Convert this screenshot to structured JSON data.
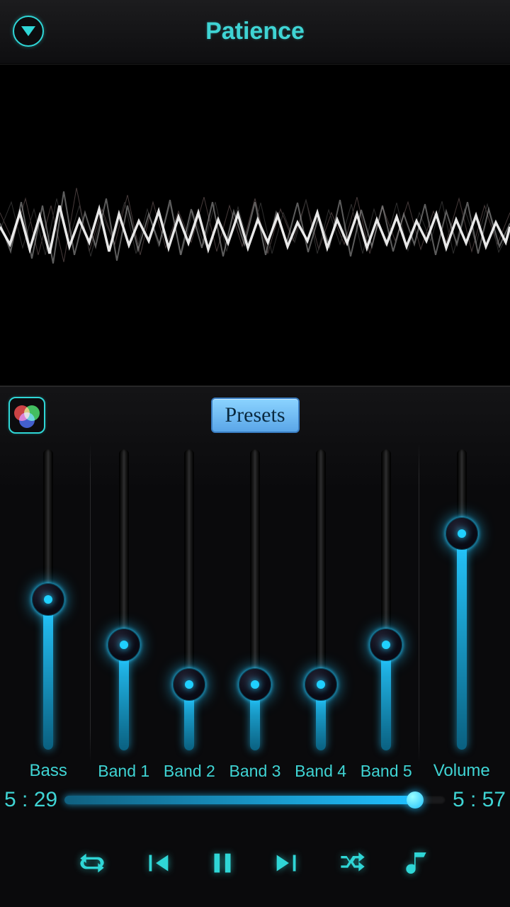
{
  "header": {
    "title": "Patience"
  },
  "equalizer": {
    "presets_label": "Presets",
    "sliders": [
      {
        "label": "Bass",
        "value": 0.5
      },
      {
        "label": "Band 1",
        "value": 0.35
      },
      {
        "label": "Band 2",
        "value": 0.22
      },
      {
        "label": "Band 3",
        "value": 0.22
      },
      {
        "label": "Band 4",
        "value": 0.22
      },
      {
        "label": "Band 5",
        "value": 0.35
      },
      {
        "label": "Volume",
        "value": 0.72
      }
    ]
  },
  "playback": {
    "current_time": "5 : 29",
    "duration": "5 : 57",
    "progress": 0.92
  }
}
